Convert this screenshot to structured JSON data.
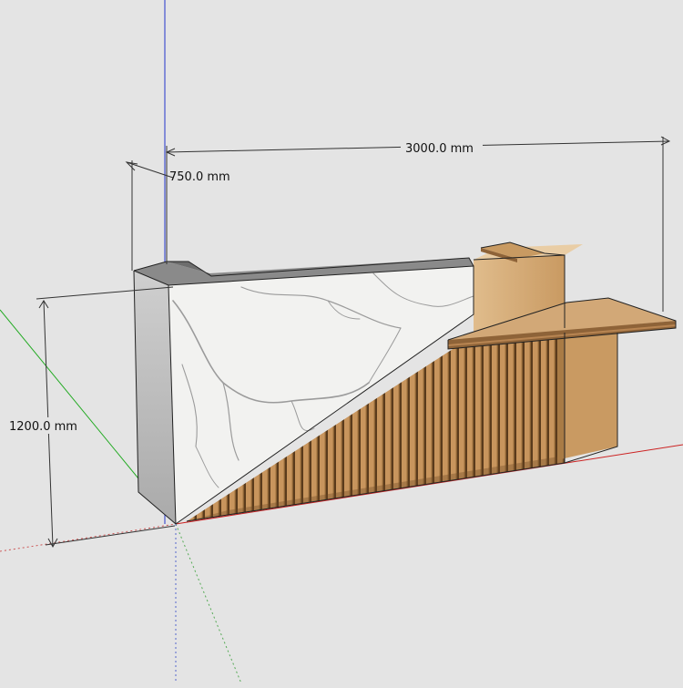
{
  "dimensions": {
    "width_label": "3000.0 mm",
    "depth_label": "750.0 mm",
    "height_label": "1200.0 mm"
  },
  "materials": {
    "marble": "#f2f2f0",
    "marble_vein": "#9b9b9b",
    "wood_light": "#d9b586",
    "wood_mid": "#c89a62",
    "wood_dark": "#8e6338",
    "side_grey": "#c2c2c2",
    "top_grey": "#8a8a8a"
  },
  "axes": {
    "red": "#cc2222",
    "green": "#22aa22",
    "blue": "#2233cc"
  }
}
